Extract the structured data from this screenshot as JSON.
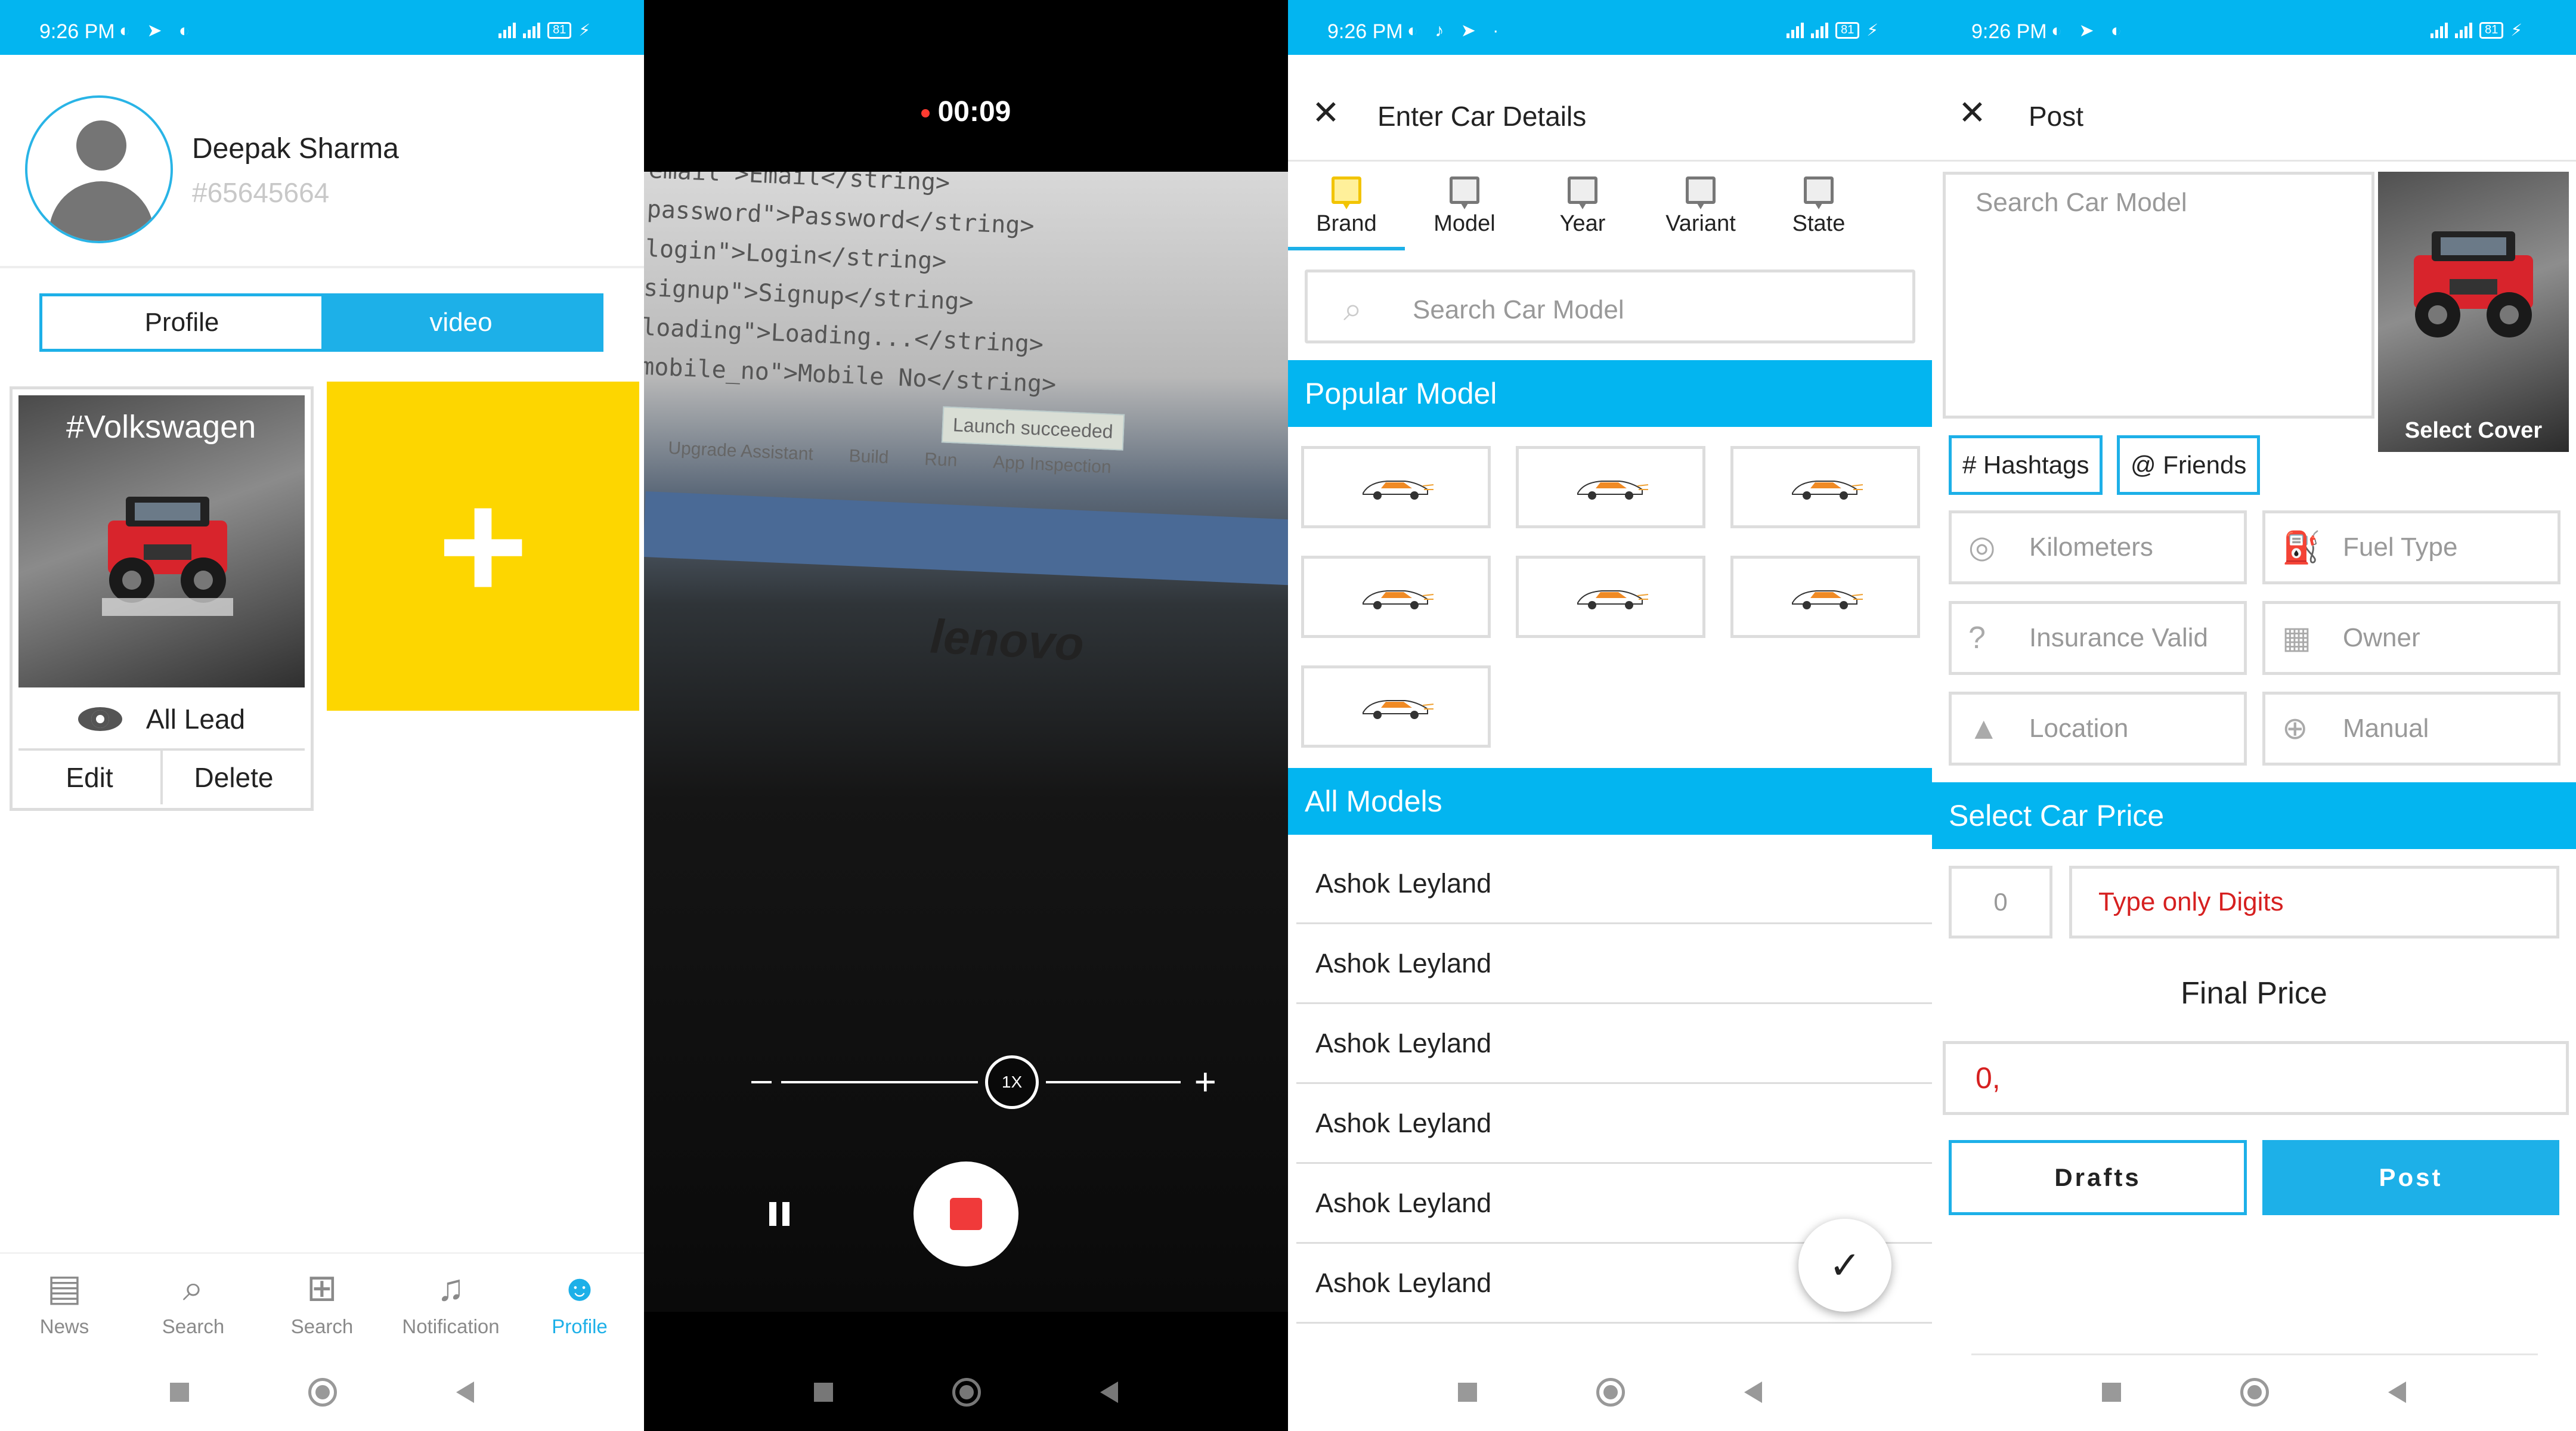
{
  "status": {
    "time": "9:26 PM",
    "battery": "81"
  },
  "profile": {
    "name": "Deepak Sharma",
    "user_id": "#65645664",
    "segment": {
      "left": "Profile",
      "right": "video"
    },
    "video_card": {
      "tag": "#Volkswagen",
      "lead_label": "All Lead",
      "edit_label": "Edit",
      "delete_label": "Delete"
    },
    "add_symbol": "+",
    "tabs": [
      {
        "label": "News",
        "icon": "news-icon"
      },
      {
        "label": "Search",
        "icon": "search-icon"
      },
      {
        "label": "Search",
        "icon": "plus-square-icon"
      },
      {
        "label": "Notification",
        "icon": "bell-icon"
      },
      {
        "label": "Profile",
        "icon": "user-icon",
        "active": true
      }
    ]
  },
  "recorder": {
    "timer": "00:09",
    "zoom": "1X",
    "background_text": {
      "line1": "email\">Email</string>",
      "line2": "password\">Password</string>",
      "line3": "login\">Login</string>",
      "line4": "signup\">Signup</string>",
      "line5": "loading\">Loading...</string>",
      "line6": "mobile_no\">Mobile No</string>",
      "launch": "Launch succeeded",
      "ide_items": [
        "Upgrade Assistant",
        "Build",
        "Run",
        "App Inspection"
      ],
      "brand": "lenovo"
    }
  },
  "car_details": {
    "title": "Enter Car Details",
    "steps": [
      "Brand",
      "Model",
      "Year",
      "Variant",
      "State"
    ],
    "active_step": "Brand",
    "search_placeholder": "Search Car Model",
    "popular_header": "Popular Model",
    "all_header": "All Models",
    "models": [
      "Ashok Leyland",
      "Ashok Leyland",
      "Ashok Leyland",
      "Ashok Leyland",
      "Ashok Leyland",
      "Ashok Leyland"
    ],
    "confirm_icon": "check-icon"
  },
  "post": {
    "title": "Post",
    "description_placeholder": "Search Car Model",
    "cover_label": "Select Cover",
    "chips": {
      "hashtags": "# Hashtags",
      "friends": "@ Friends"
    },
    "fields": {
      "kilometers": "Kilometers",
      "fuel_type": "Fuel Type",
      "insurance": "Insurance Valid",
      "owner": "Owner",
      "location": "Location",
      "manual": "Manual"
    },
    "price_header": "Select Car Price",
    "price_value": "0",
    "price_hint": "Type only Digits",
    "final_label": "Final Price",
    "final_value": "0,",
    "drafts": "Drafts",
    "post_btn": "Post"
  },
  "colors": {
    "accent": "#03b5f0",
    "tile_yellow": "#fdd600",
    "price_red": "#d62020",
    "record_red": "#f03a3a"
  }
}
